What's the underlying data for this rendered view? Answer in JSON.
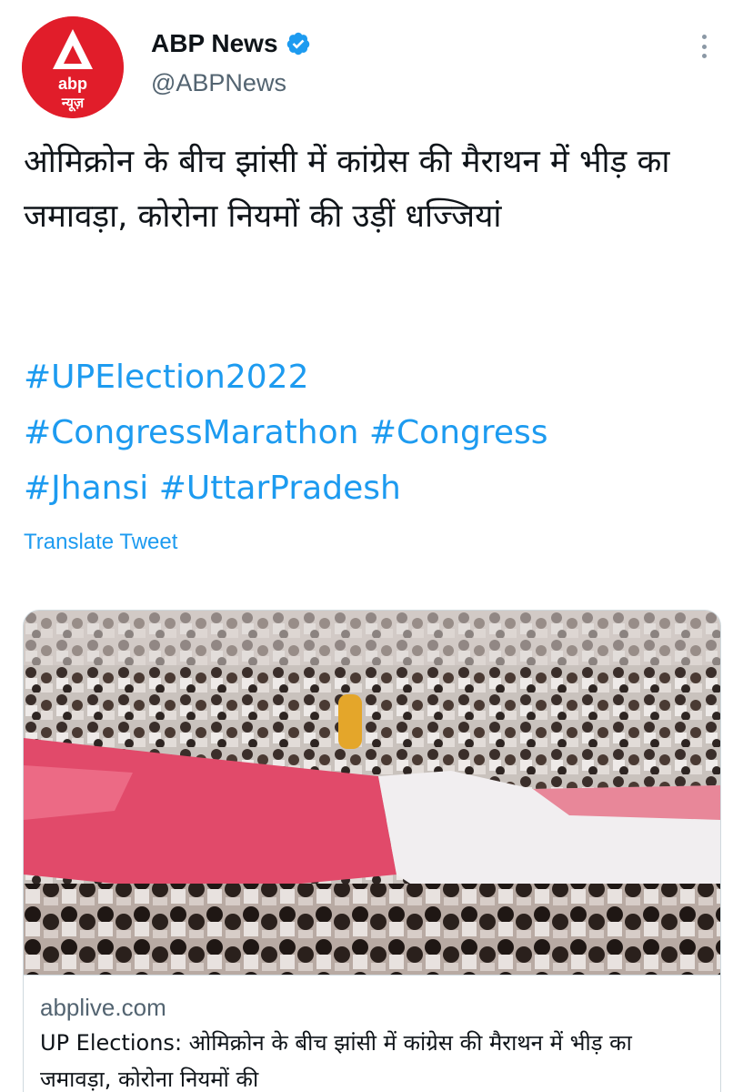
{
  "tweet": {
    "author": {
      "name": "ABP News",
      "handle": "@ABPNews",
      "avatar": {
        "logo_text": "abp",
        "logo_subtext": "न्यूज़",
        "brand_color": "#e11d2a"
      },
      "verified": true
    },
    "text": "ओमिक्रोन के बीच झांसी में कांग्रेस की मैराथन में भीड़ का जमावड़ा, कोरोना नियमों की उड़ीं धज्जियां",
    "hashtags": [
      "#UPElection2022",
      "#CongressMarathon",
      "#Congress",
      "#Jhansi",
      "#UttarPradesh"
    ],
    "translate_label": "Translate Tweet"
  },
  "card": {
    "domain": "abplive.com",
    "title": "UP Elections: ओमिक्रोन के बीच झांसी में कांग्रेस की मैराथन में भीड़ का जमावड़ा, कोरोना नियमों की"
  },
  "colors": {
    "link": "#1d9bf0",
    "text": "#0f1419",
    "secondary": "#536471",
    "border": "#cfd9de"
  },
  "icons": {
    "verified": "verified-badge-icon",
    "more": "more-options-icon"
  }
}
